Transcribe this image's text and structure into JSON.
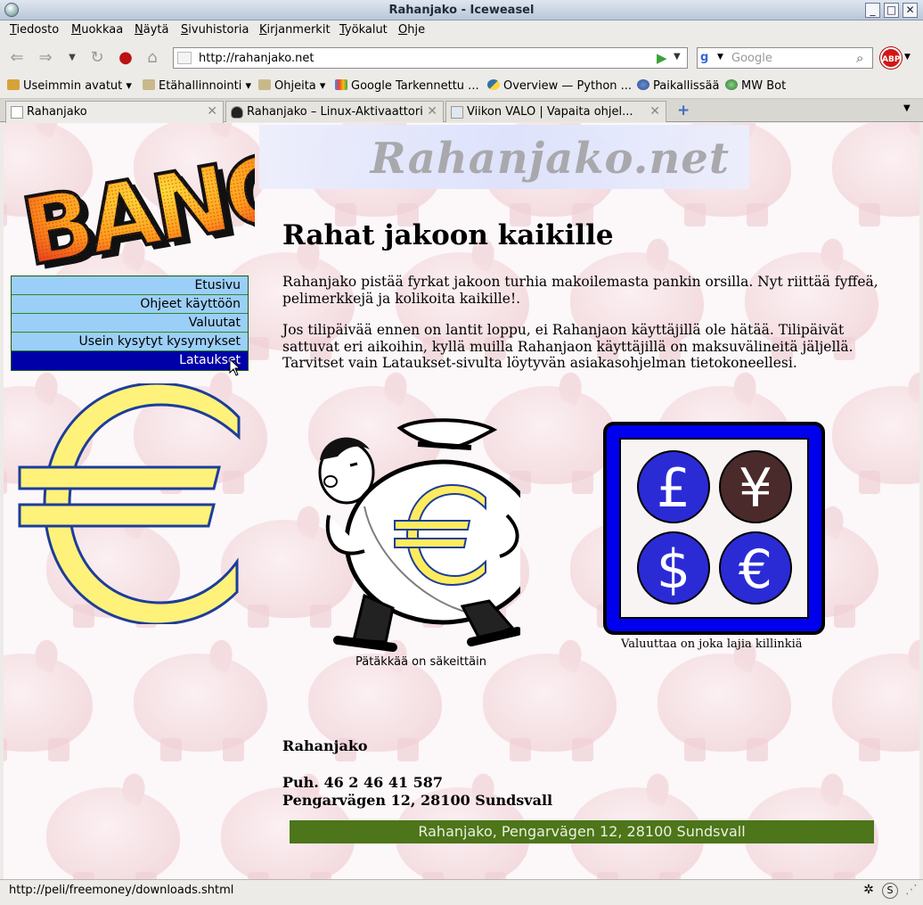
{
  "window": {
    "title": "Rahanjako - Iceweasel",
    "min_label": "_",
    "max_label": "□",
    "close_label": "✕"
  },
  "menubar": [
    "Tiedosto",
    "Muokkaa",
    "Näytä",
    "Sivuhistoria",
    "Kirjanmerkit",
    "Työkalut",
    "Ohje"
  ],
  "navbar": {
    "url": "http://rahanjako.net",
    "search_placeholder": "Google",
    "adblock_label": "ABP"
  },
  "bookmarks": [
    {
      "label": "Useimmin avatut",
      "dropdown": true,
      "icon": "folder-star-icon"
    },
    {
      "label": "Etähallinnointi",
      "dropdown": true,
      "icon": "folder-icon"
    },
    {
      "label": "Ohjeita",
      "dropdown": true,
      "icon": "folder-icon"
    },
    {
      "label": "Google Tarkennettu ...",
      "dropdown": false,
      "icon": "google-icon"
    },
    {
      "label": "Overview — Python ...",
      "dropdown": false,
      "icon": "python-icon"
    },
    {
      "label": "Paikallissää",
      "dropdown": false,
      "icon": "globe-icon"
    },
    {
      "label": "MW Bot",
      "dropdown": false,
      "icon": "bot-icon"
    }
  ],
  "tabs": [
    {
      "label": "Rahanjako",
      "active": true
    },
    {
      "label": "Rahanjako – Linux-Aktivaattori",
      "active": false
    },
    {
      "label": "Viikon VALO | Vapaita ohjel...",
      "active": false
    }
  ],
  "page": {
    "site_name": "Rahanjako.net",
    "bang_text": "BANG",
    "nav": [
      "Etusivu",
      "Ohjeet käyttöön",
      "Valuutat",
      "Usein kysytyt kysymykset",
      "Lataukset"
    ],
    "nav_active_index": 4,
    "heading": "Rahat jakoon kaikille",
    "paragraph1": "Rahanjako pistää fyrkat jakoon turhia makoilemasta pankin orsilla. Nyt riittää fyffeä, pelimerkkejä ja kolikoita kaikille!.",
    "paragraph2": "Jos tilipäivää ennen on lantit loppu, ei Rahanjaon käyttäjillä ole hätää. Tilipäivät sattuvat eri aikoihin, kyllä muilla Rahanjaon käyttäjillä on maksuvälineitä jäljellä. Tarvitset vain Lataukset-sivulta löytyvän asiakasohjelman tietokoneellesi.",
    "caption1": "Pätäkkää on säkeittäin",
    "caption2": "Valuuttaa on joka lajia killinkiä",
    "currency_symbols": [
      "£",
      "¥",
      "$",
      "€"
    ],
    "contact_name": "Rahanjako",
    "contact_phone": "Puh. 46 2 46 41 587",
    "contact_address": "Pengarvägen 12, 28100 Sundsvall",
    "footer": "Rahanjako, Pengarvägen 12, 28100 Sundsvall"
  },
  "status": {
    "text": "http://peli/freemoney/downloads.shtml"
  },
  "colors": {
    "nav_bg": "#9ccff7",
    "nav_active_bg": "#0000a8",
    "footer_bg": "#4d7519",
    "euro_fill": "#fff06e",
    "euro_stroke": "#1d3d99"
  }
}
